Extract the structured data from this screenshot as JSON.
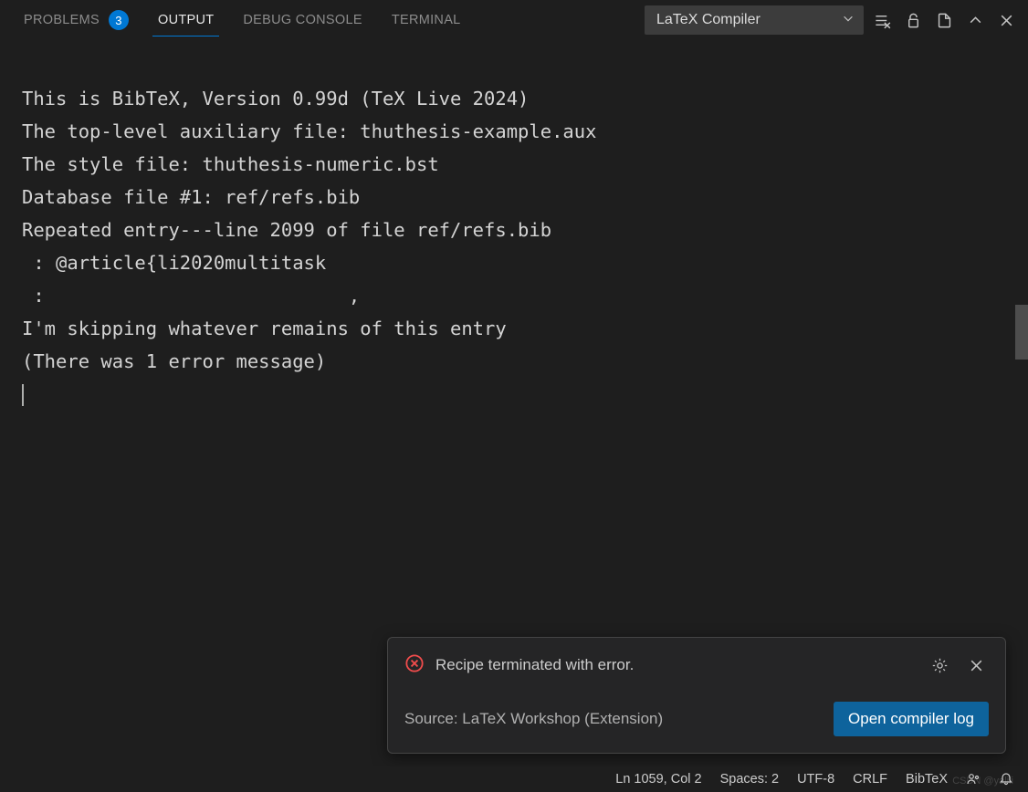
{
  "tabs": {
    "problems": {
      "label": "PROBLEMS",
      "badge": "3"
    },
    "output": {
      "label": "OUTPUT"
    },
    "debug": {
      "label": "DEBUG CONSOLE"
    },
    "terminal": {
      "label": "TERMINAL"
    }
  },
  "panel": {
    "filter_selected": "LaTeX Compiler"
  },
  "output_lines": [
    "This is BibTeX, Version 0.99d (TeX Live 2024)",
    "The top-level auxiliary file: thuthesis-example.aux",
    "The style file: thuthesis-numeric.bst",
    "Database file #1: ref/refs.bib",
    "Repeated entry---line 2099 of file ref/refs.bib",
    " : @article{li2020multitask",
    " :                           ,",
    "I'm skipping whatever remains of this entry",
    "(There was 1 error message)"
  ],
  "notification": {
    "message": "Recipe terminated with error.",
    "source": "Source: LaTeX Workshop (Extension)",
    "action_label": "Open compiler log"
  },
  "status": {
    "position": "Ln 1059, Col 2",
    "spaces": "Spaces: 2",
    "encoding": "UTF-8",
    "eol": "CRLF",
    "language": "BibTeX"
  },
  "watermark": "CSDN @yalili"
}
